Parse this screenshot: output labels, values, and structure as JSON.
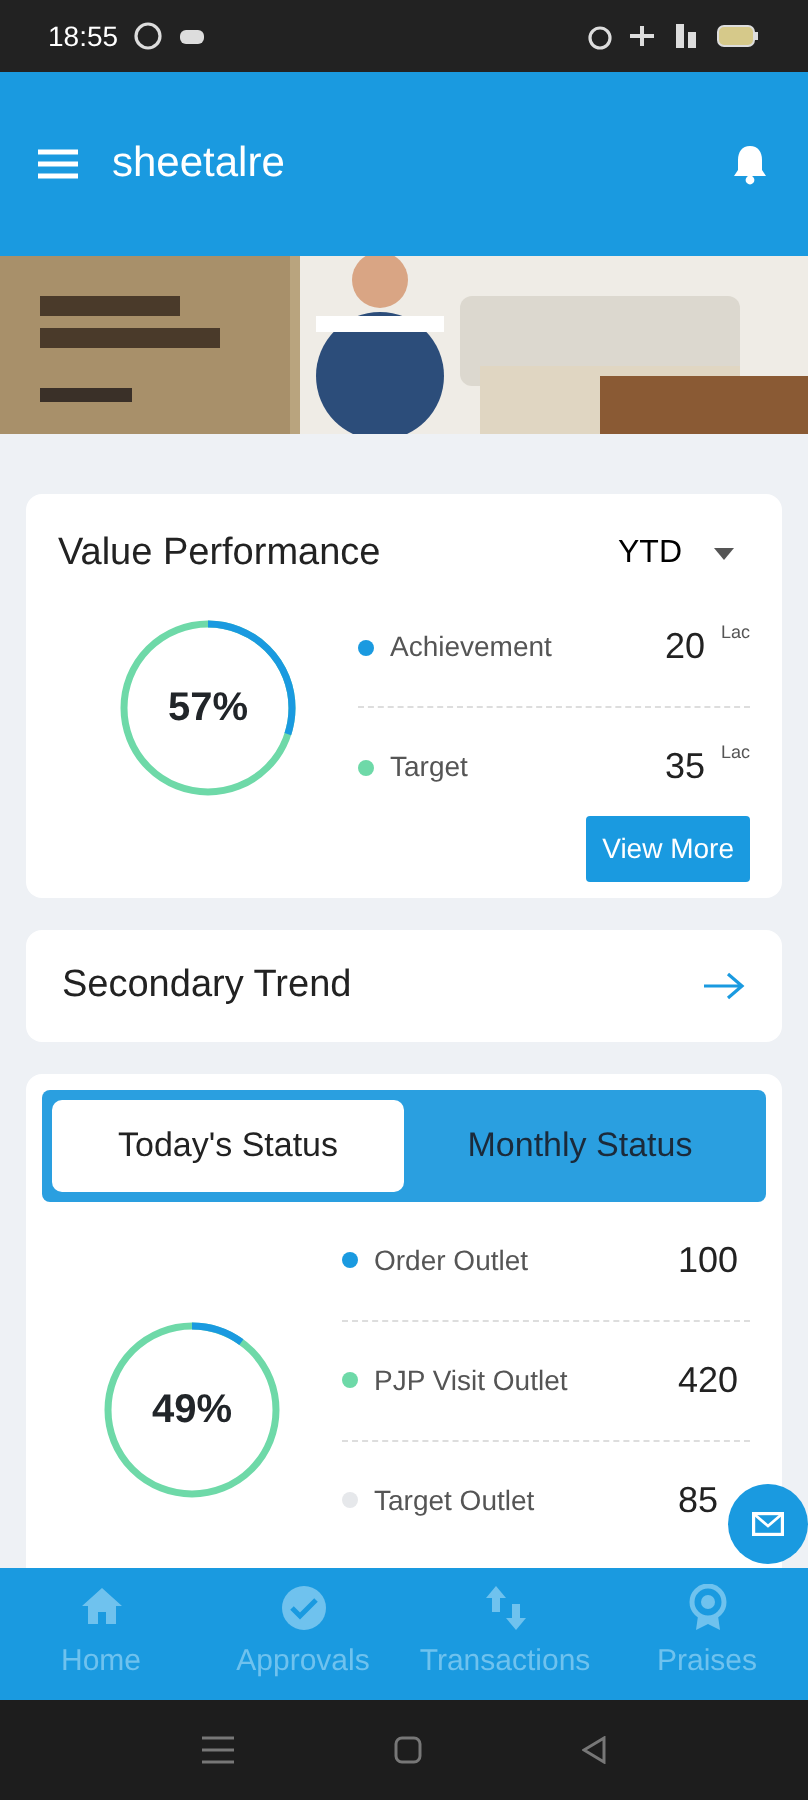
{
  "status_bar": {
    "time": "18:55"
  },
  "app_bar": {
    "title": "sheetalre"
  },
  "value_performance": {
    "title": "Value Performance",
    "period": "YTD",
    "percent": "57%",
    "items": [
      {
        "label": "Achievement",
        "value": "20",
        "unit": "Lac",
        "color": "#1a9ae0"
      },
      {
        "label": "Target",
        "value": "35",
        "unit": "Lac",
        "color": "#6ed9a8"
      }
    ],
    "button": "View More"
  },
  "secondary_trend": {
    "title": "Secondary Trend"
  },
  "status_card": {
    "tabs": [
      {
        "label": "Today's Status",
        "selected": true
      },
      {
        "label": "Monthly Status",
        "selected": false
      }
    ],
    "percent": "49%",
    "items": [
      {
        "label": "Order Outlet",
        "value": "100",
        "color": "#1a9ae0"
      },
      {
        "label": "PJP Visit Outlet",
        "value": "420",
        "color": "#6ed9a8"
      },
      {
        "label": "Target Outlet",
        "value": "85",
        "color": "#e6e8eb"
      }
    ]
  },
  "bottom_nav": [
    {
      "label": "Home",
      "kind": "home"
    },
    {
      "label": "Approvals",
      "kind": "check"
    },
    {
      "label": "Transactions",
      "kind": "swap"
    },
    {
      "label": "Praises",
      "kind": "award"
    }
  ]
}
